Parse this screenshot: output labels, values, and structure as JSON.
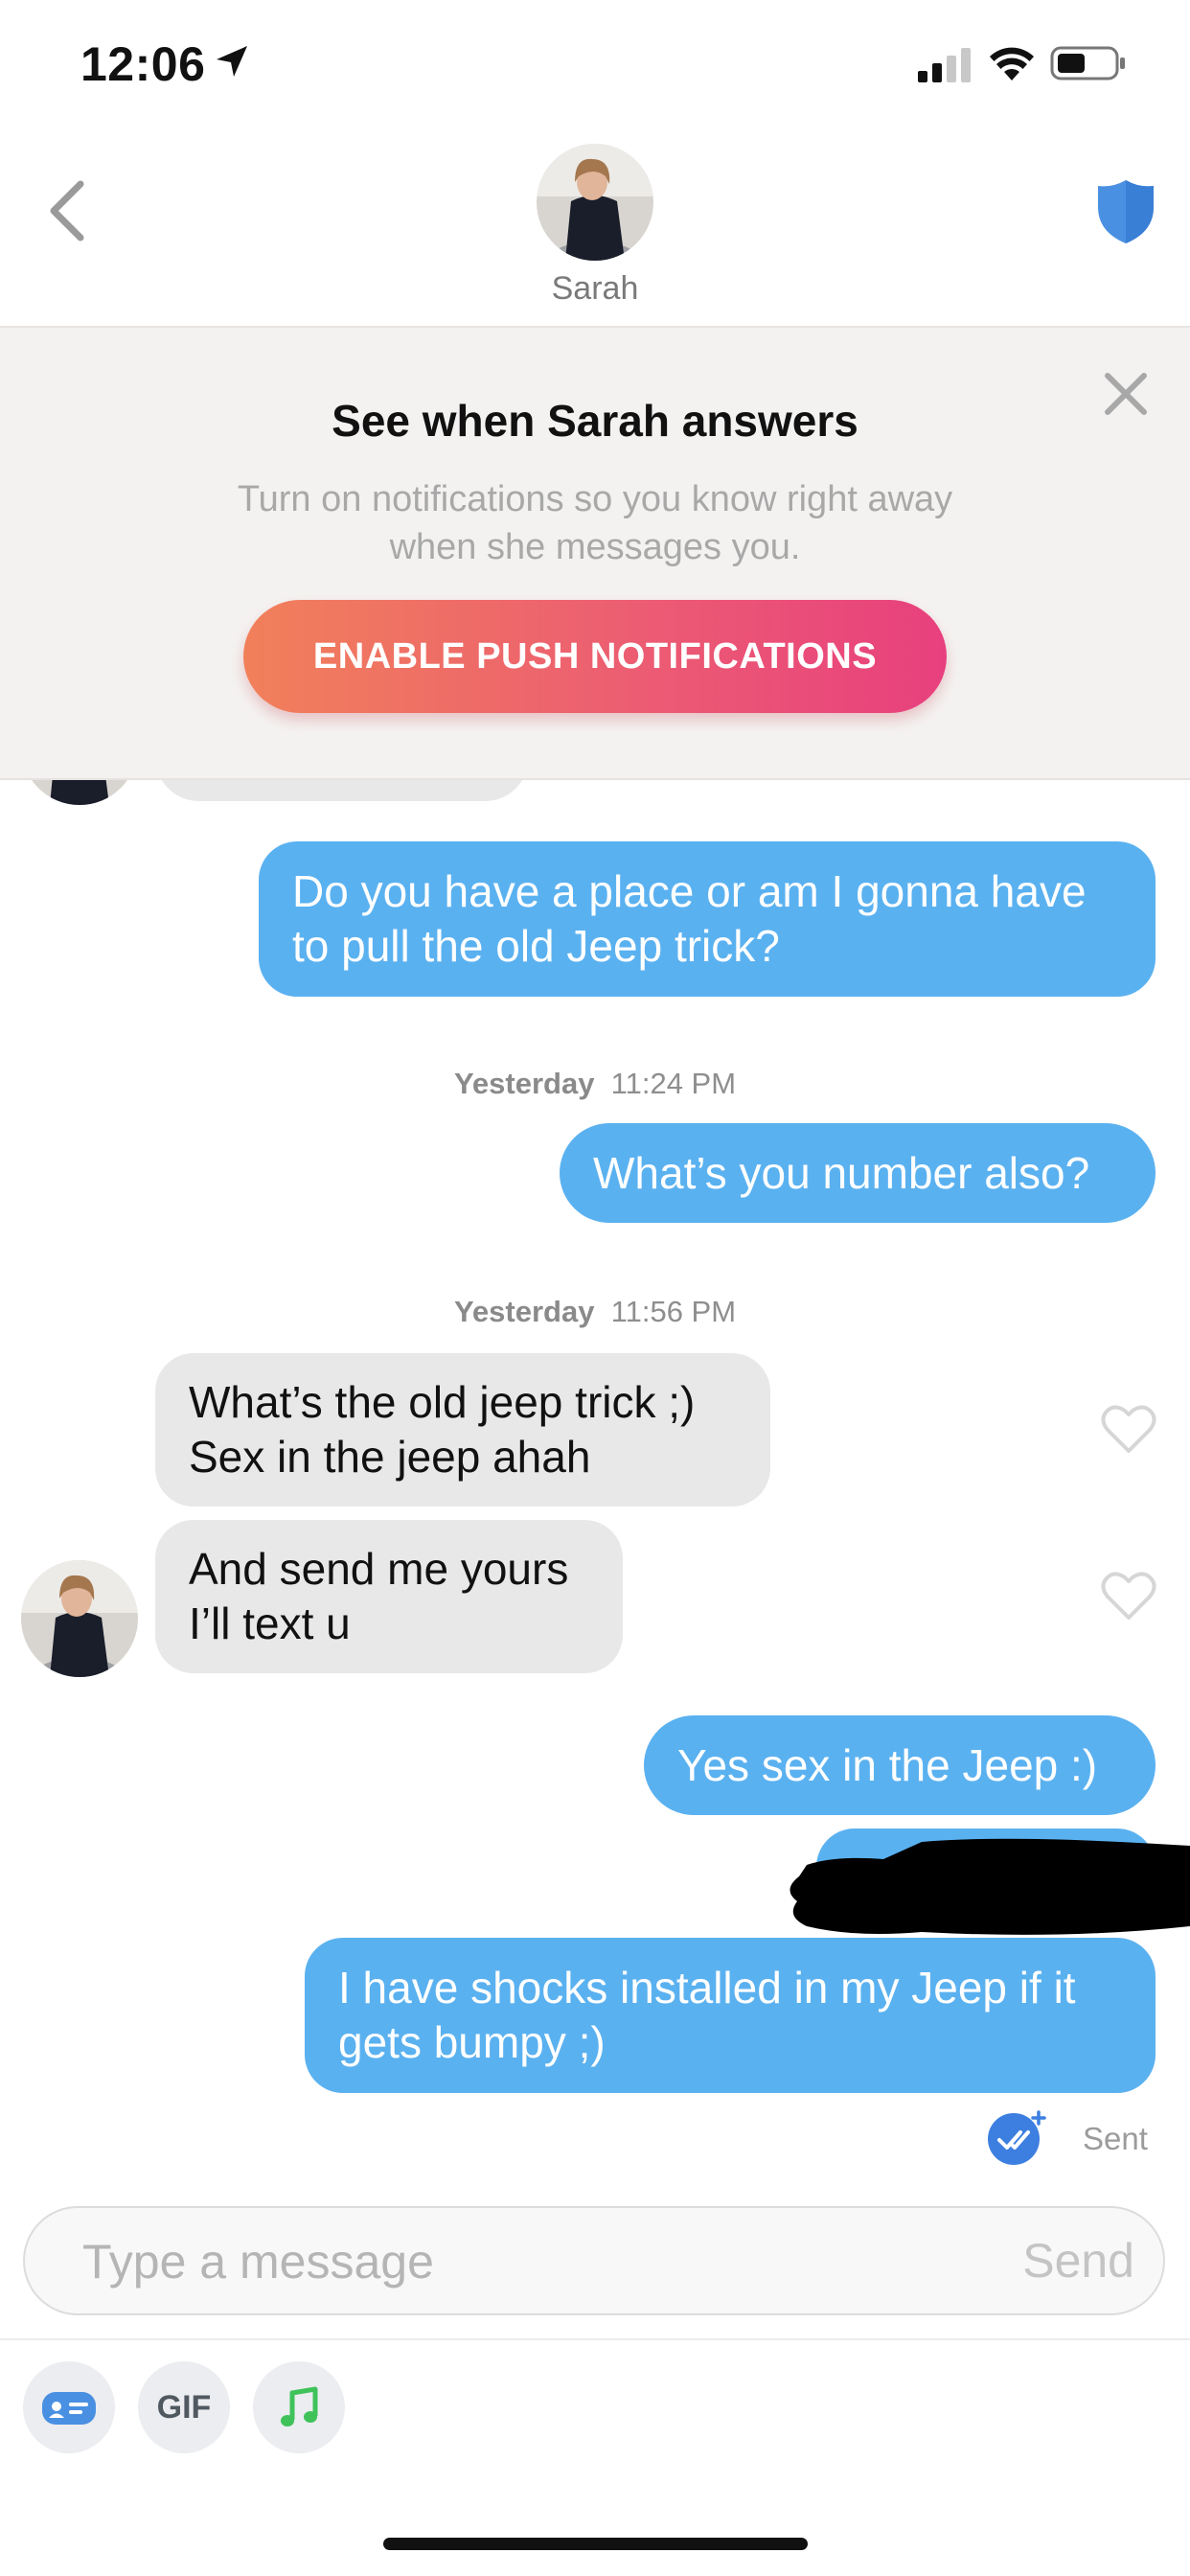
{
  "status_bar": {
    "time": "12:06"
  },
  "header": {
    "name": "Sarah"
  },
  "banner": {
    "title": "See when Sarah answers",
    "description": "Turn on notifications so you know right away when she messages you.",
    "button_label": "ENABLE PUSH NOTIFICATIONS"
  },
  "messages": {
    "m1": "Do you have a place or am I gonna have to pull the old Jeep trick?",
    "ts1_day": "Yesterday",
    "ts1_time": "11:24 PM",
    "m2": "What’s you number also?",
    "ts2_day": "Yesterday",
    "ts2_time": "11:56 PM",
    "m3": "What’s the old jeep trick ;)\nSex in the jeep ahah",
    "m4": "And send me yours\nI’ll text u",
    "m5": "Yes sex in the Jeep :)",
    "m7": "I have shocks installed in my Jeep if it gets bumpy ;)",
    "status": "Sent"
  },
  "composer": {
    "placeholder": "Type a message",
    "send_label": "Send",
    "gif_label": "GIF"
  },
  "colors": {
    "outgoing_bubble": "#5ab1f0",
    "incoming_bubble": "#e8e8e8",
    "button_gradient_start": "#f1805a",
    "button_gradient_end": "#e8407e",
    "shield": "#4a90e2"
  },
  "icons": [
    "location-arrow-icon",
    "signal-icon",
    "wifi-icon",
    "battery-icon",
    "back-chevron-icon",
    "safety-shield-icon",
    "close-icon",
    "heart-icon",
    "read-receipt-icon",
    "contact-card-icon",
    "music-note-icon"
  ]
}
